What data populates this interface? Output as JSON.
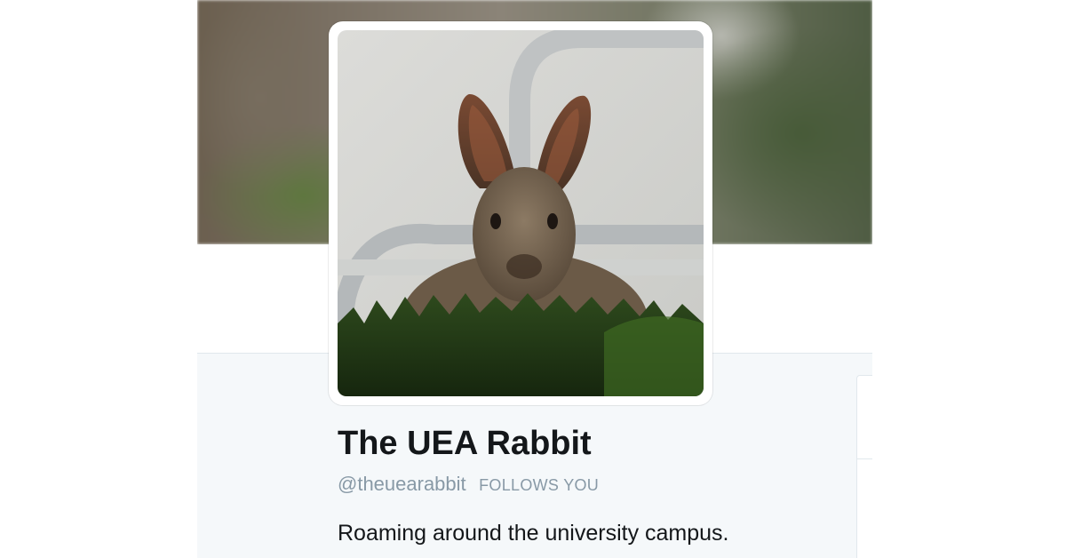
{
  "profile": {
    "display_name": "The UEA Rabbit",
    "handle": "@theuearabbit",
    "follows_you": "FOLLOWS YOU",
    "bio": "Roaming around the university campus."
  },
  "colors": {
    "name_text": "#14171a",
    "muted_text": "#8899a6",
    "profile_background": "#f5f8fa",
    "border": "#e1e8ed"
  }
}
